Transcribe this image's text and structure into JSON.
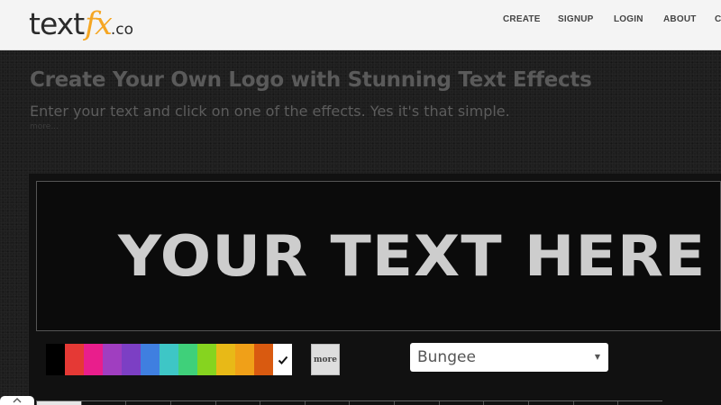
{
  "header": {
    "logo": {
      "text": "text",
      "fx": "fx",
      "co": ".co"
    },
    "nav": [
      "CREATE",
      "SIGNUP",
      "LOGIN",
      "ABOUT",
      "C"
    ]
  },
  "hero": {
    "title": "Create Your Own Logo with Stunning Text Effects",
    "subtitle": "Enter your text and click on one of the effects. Yes it's that simple.",
    "more_link": "more..."
  },
  "editor": {
    "preview_text": "YOUR TEXT HERE",
    "colors": [
      "#000000",
      "#e53935",
      "#e91e8c",
      "#a03ec0",
      "#7c3fc4",
      "#3f7fe0",
      "#3ec6c6",
      "#3fd07a",
      "#86d41f",
      "#e8b917",
      "#f0a018",
      "#d95a10",
      "#ffffff"
    ],
    "selected_color_index": 12,
    "more_button": "more",
    "font_select": {
      "value": "Bungee"
    }
  },
  "colors": {
    "accent": "#f5a623",
    "header_bg": "#f4f4f4",
    "page_bg": "#1e1e1e",
    "preview_text": "#cdcdcd"
  }
}
